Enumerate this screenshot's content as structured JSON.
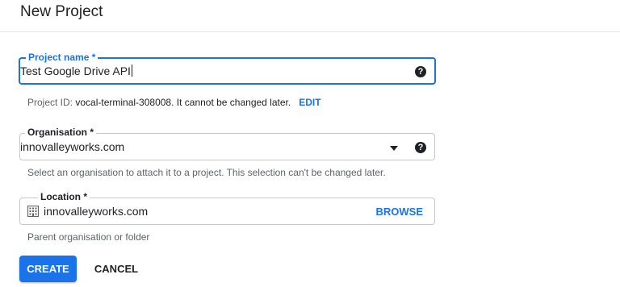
{
  "header": {
    "title": "New Project"
  },
  "project_name": {
    "label": "Project name *",
    "value": "Test Google Drive API",
    "help_icon": "help-icon",
    "hint_prefix": "Project ID: ",
    "project_id": "vocal-terminal-308008",
    "hint_suffix": ". It cannot be changed later.",
    "edit_label": "EDIT"
  },
  "organisation": {
    "label": "Organisation *",
    "value": "innovalleyworks.com",
    "hint": "Select an organisation to attach it to a project. This selection can't be changed later."
  },
  "location": {
    "label": "Location *",
    "value": "innovalleyworks.com",
    "icon": "building-icon",
    "browse_label": "BROWSE",
    "hint": "Parent organisation or folder"
  },
  "actions": {
    "create_label": "CREATE",
    "cancel_label": "CANCEL"
  },
  "colors": {
    "accent": "#1a73e8",
    "text": "#202124",
    "hint": "#5f6368",
    "border": "#c8c8c8"
  }
}
